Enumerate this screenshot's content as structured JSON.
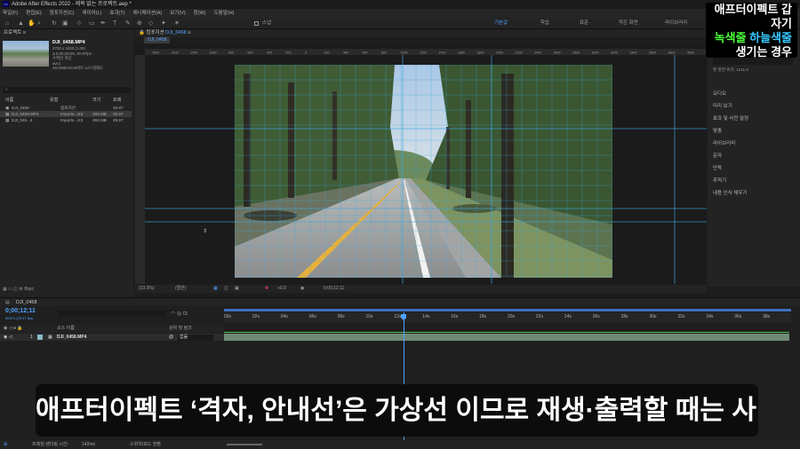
{
  "window": {
    "title": "Adobe After Effects 2022 - 제목 없는 프로젝트.aep *"
  },
  "menu": [
    "파일(F)",
    "편집(E)",
    "컴포지션(C)",
    "레이어(L)",
    "효과(T)",
    "애니메이션(A)",
    "보기(V)",
    "창(W)",
    "도움말(H)"
  ],
  "toolbar": {
    "snap_label": "스냅",
    "workspaces": [
      "기본값",
      "학습",
      "표준",
      "작은 화면",
      "라이브러리"
    ],
    "active_workspace": "기본값"
  },
  "project": {
    "panel_title": "프로젝트",
    "file_name": "DJI_0458.MP4",
    "file_info": [
      "2720 x 1530 (1.00)",
      "Δ 0;00;29;29, 29.97fps",
      "수백만 색상",
      "avc1",
      "48.000kHz/16비트 U/스테레오"
    ],
    "search_placeholder": "",
    "columns": [
      "이름",
      "유형",
      "크기",
      "프레"
    ],
    "rows": [
      {
        "name": "DJI_0458",
        "type": "컴포지션",
        "size": "",
        "fps": "29.97"
      },
      {
        "name": "DJI_0458.MP4",
        "type": "Importe...EX",
        "size": "283 MB",
        "fps": "29.97"
      },
      {
        "name": "DJI_045...4",
        "type": "Importe...EX",
        "size": "283 MB",
        "fps": "29.97"
      }
    ],
    "footer": "8bpc"
  },
  "composition": {
    "panel_title": "컴포지션",
    "comp_name": "DJI_0458",
    "breadcrumb": "DJI_0458",
    "zoom": "(33.3%)",
    "resolution": "(절반)",
    "timecode": "0;00;12;11",
    "exposure": "+0.0",
    "ruler_labels": [
      "1600",
      "1400",
      "1200",
      "1000",
      "800",
      "600",
      "400",
      "200",
      "0",
      "200",
      "400",
      "600",
      "800",
      "1000",
      "1200",
      "1400",
      "1600",
      "1800",
      "2000",
      "2200",
      "2400",
      "2600",
      "2800",
      "3000",
      "3200",
      "3400",
      "3600",
      "3800",
      "4000",
      "4200"
    ]
  },
  "right_panel": {
    "position_label": "맨 앞면 위치: 1141.0",
    "items": [
      "오디오",
      "미리 보기",
      "효과 및 사전 설정",
      "맞춤",
      "라이브러리",
      "문자",
      "단락",
      "추적기",
      "내용 인식 채우기"
    ]
  },
  "timeline": {
    "tab": "DJI_0458",
    "timecode": "0;00;12;11",
    "timecode_sub": "00371 (29.97 fps)",
    "column_headers": [
      "소스 이름",
      "상위 및 링크"
    ],
    "layer": {
      "index": "1",
      "name": "DJI_0458.MP4",
      "parent": "없음"
    },
    "ticks": [
      "00s",
      "02s",
      "04s",
      "06s",
      "08s",
      "10s",
      "12s",
      "14s",
      "16s",
      "18s",
      "20s",
      "22s",
      "24s",
      "26s",
      "28s",
      "30s",
      "32s",
      "34s",
      "36s",
      "38s"
    ],
    "playhead_ratio": 0.316,
    "bottom": {
      "render_label": "프레임 렌더링 시간:",
      "render_time": "142ms",
      "switch_label": "스위치/모드 전환"
    }
  },
  "overlay": {
    "caption": "애프터이펙트 ‘격자, 안내선’은 가상선 이므로 재생·출력할 때는 사라집니다",
    "banner_line1": "애프터이펙트 갑자기",
    "banner_green": "녹색줄",
    "banner_blue": "하늘색줄",
    "banner_line3": "생기는 경우",
    "color_green": "#4cff3a",
    "color_blue": "#38c8ff"
  },
  "colors": {
    "accent": "#4fa2ff",
    "guide": "#3aa8e0",
    "layer_bar": "#6e8a76"
  }
}
